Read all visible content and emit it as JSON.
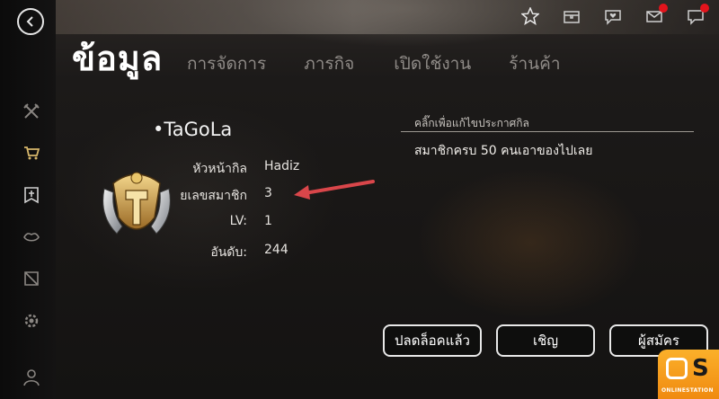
{
  "page": {
    "title": "ข้อมูล"
  },
  "tabs": [
    {
      "label": "การจัดการ"
    },
    {
      "label": "ภารกิจ"
    },
    {
      "label": "เปิดใช้งาน"
    },
    {
      "label": "ร้านค้า"
    }
  ],
  "sidebar": {
    "icons": [
      "crossed-swords-icon",
      "cart-icon",
      "guild-banner-icon",
      "lips-icon",
      "map-icon",
      "settings-icon",
      "user-icon"
    ]
  },
  "top_icons": [
    "star-icon",
    "treasure-chest-icon",
    "chat-heart-icon",
    "mail-icon",
    "speech-bubble-icon"
  ],
  "guild": {
    "name": "•TaGoLa",
    "rows": [
      {
        "label": "หัวหน้ากิล",
        "value": "Hadiz"
      },
      {
        "label": "ยเลขสมาชิก",
        "value": "3"
      },
      {
        "label": "LV:",
        "value": "1"
      },
      {
        "label": "อันดับ:",
        "value": "244"
      }
    ]
  },
  "notice": {
    "hint": "คลิ๊กเพื่อแก้ไขประกาศกิล",
    "text": "สมาชิกครบ 50 คนเอาของไปเลย"
  },
  "buttons": {
    "unlocked": "ปลดล็อคแล้ว",
    "invite": "เชิญ",
    "applicants": "ผู้สมัคร"
  },
  "watermark": {
    "brand": "ONLINESTATION",
    "letter": "S"
  },
  "colors": {
    "notification_dot": "#e3141c",
    "annotation_arrow": "#d9464a",
    "watermark_orange": "#f59a1a"
  }
}
